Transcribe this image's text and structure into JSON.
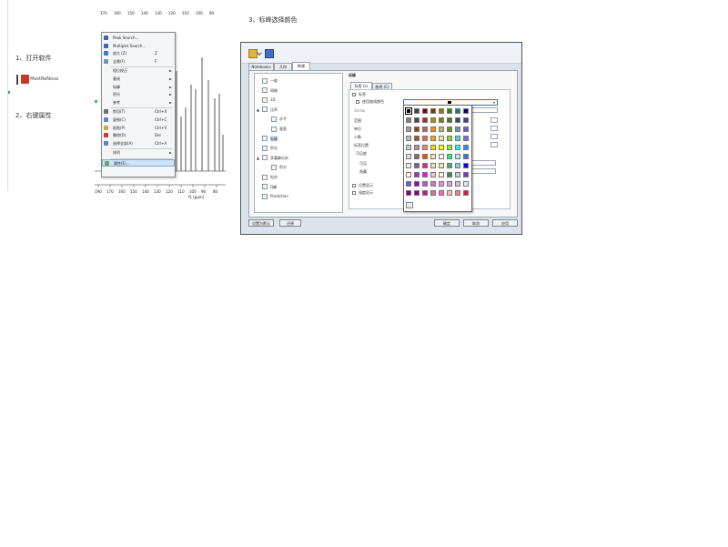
{
  "steps": {
    "step1": "1、打开软件",
    "step2": "2、右键属性",
    "step3": "3、标峰选择颜色"
  },
  "app": {
    "name": "MestReNova",
    "icon": "mestrenova-logo-icon"
  },
  "spectrum": {
    "tick_labels": [
      "190",
      "170",
      "160",
      "150",
      "140",
      "130",
      "120",
      "110",
      "100",
      "90",
      "80"
    ],
    "axis_title": "f1 (ppm)",
    "peak_labels": [
      "170",
      "160",
      "150",
      "140",
      "130",
      "120",
      "110",
      "100",
      "90"
    ]
  },
  "context_menu": {
    "items": [
      {
        "label": "Peak Search...",
        "shortcut": "",
        "arrow": "",
        "icon": "peak-search-icon",
        "color": "#3a62b8"
      },
      {
        "label": "Multiplet Search...",
        "shortcut": "",
        "arrow": "",
        "icon": "multiplet-search-icon",
        "color": "#3a62b8"
      },
      {
        "label": "放大 (Z)",
        "shortcut": "Z",
        "arrow": "",
        "icon": "zoom-in-icon",
        "color": "#2a7fd4"
      },
      {
        "label": "全景(F)",
        "shortcut": "F",
        "arrow": "",
        "icon": "full-view-icon",
        "color": "#6a8fb7"
      },
      {
        "label": "相位校正",
        "shortcut": "",
        "arrow": "►",
        "icon": "",
        "color": ""
      },
      {
        "label": "基线",
        "shortcut": "",
        "arrow": "►",
        "icon": "",
        "color": ""
      },
      {
        "label": "标峰",
        "shortcut": "",
        "arrow": "►",
        "icon": "",
        "color": ""
      },
      {
        "label": "积分",
        "shortcut": "",
        "arrow": "►",
        "icon": "",
        "color": ""
      },
      {
        "label": "参考",
        "shortcut": "",
        "arrow": "►",
        "icon": "",
        "color": ""
      },
      {
        "label": "剪切(T)",
        "shortcut": "Ctrl+X",
        "arrow": "",
        "icon": "cut-icon",
        "color": "#6d6d6d"
      },
      {
        "label": "复制(C)",
        "shortcut": "Ctrl+C",
        "arrow": "",
        "icon": "copy-icon",
        "color": "#5a84c2"
      },
      {
        "label": "粘贴(P)",
        "shortcut": "Ctrl+V",
        "arrow": "",
        "icon": "paste-icon",
        "color": "#d6a43a"
      },
      {
        "label": "删除(D)",
        "shortcut": "Del",
        "arrow": "",
        "icon": "delete-icon",
        "color": "#d0342c"
      },
      {
        "label": "选择全部(A)",
        "shortcut": "Ctrl+A",
        "arrow": "",
        "icon": "select-all-icon",
        "color": "#5a84c2"
      },
      {
        "label": "排列",
        "shortcut": "",
        "arrow": "►",
        "icon": "",
        "color": ""
      },
      {
        "label": "属性(E)...",
        "shortcut": "",
        "arrow": "",
        "icon": "properties-icon",
        "color": "#6aa84f"
      }
    ]
  },
  "dialog": {
    "tabs": [
      "Notebooks",
      "几何",
      "种谱"
    ],
    "tree": [
      {
        "label": "一般",
        "icon": "general-icon",
        "indent": 0
      },
      {
        "label": "网格",
        "icon": "grid-icon",
        "indent": 0
      },
      {
        "label": "1D",
        "icon": "1d-icon",
        "indent": 0
      },
      {
        "label": "比率",
        "icon": "ratio-icon",
        "indent": 0,
        "expand": "▲"
      },
      {
        "label": "水平",
        "icon": "horizontal-icon",
        "indent": 1
      },
      {
        "label": "垂直",
        "icon": "vertical-icon",
        "indent": 1
      },
      {
        "label": "标峰",
        "icon": "peak-label-icon",
        "indent": 0
      },
      {
        "label": "积分",
        "icon": "integral-icon",
        "indent": 0
      },
      {
        "label": "多重峰分析",
        "icon": "multiplet-icon",
        "indent": 0,
        "expand": "▲"
      },
      {
        "label": "积分",
        "icon": "integral-icon",
        "indent": 1
      },
      {
        "label": "拟合",
        "icon": "fit-icon",
        "indent": 0
      },
      {
        "label": "Q峰",
        "icon": "q-peak-icon",
        "indent": 0
      },
      {
        "label": "Prediction",
        "icon": "prediction-icon",
        "indent": 0
      }
    ],
    "section_title": "标峰",
    "sub_tabs": [
      "标签 (L)",
      "曲线 (C)"
    ],
    "labels": {
      "show_label": "标签",
      "use_curve_color": "使用曲线颜色",
      "stellar": "Stellar",
      "range": "范围",
      "unit": "单位",
      "decimals": "小数",
      "label_position": "标签位置",
      "visibility": "可见度",
      "visible": "可见",
      "hidden": "隐藏",
      "position_show": "位置显示",
      "intensity_show": "强度显示"
    },
    "more_button": "...",
    "buttons": {
      "set_default": "设置为默认",
      "restore": "还原",
      "ok": "确定",
      "cancel": "取消",
      "apply": "应用"
    },
    "selected_color": "#000000",
    "palette_colors": [
      [
        "#000000",
        "#404040",
        "#7f0000",
        "#7f3f00",
        "#7f7f00",
        "#3f7f00",
        "#007f7f",
        "#00007f"
      ],
      [
        "#808080",
        "#5f3f3f",
        "#a52a2a",
        "#b8860b",
        "#808000",
        "#556b2f",
        "#2f4f4f",
        "#483d8b"
      ],
      [
        "#a0a0a0",
        "#8b4513",
        "#cd5c5c",
        "#ff8c00",
        "#bdb76b",
        "#6b8e23",
        "#5f9ea0",
        "#6a5acd"
      ],
      [
        "#c0c0c0",
        "#a0522d",
        "#ff6347",
        "#ffa500",
        "#f0e68c",
        "#9acd32",
        "#40e0d0",
        "#7b68ee"
      ],
      [
        "#d0d0d0",
        "#bc8f8f",
        "#fa8072",
        "#ffd700",
        "#ffff00",
        "#7cfc00",
        "#00ffff",
        "#1e90ff"
      ],
      [
        "#e0e0e0",
        "#996666",
        "#ff4500",
        "#ffdead",
        "#ffffe0",
        "#00ff7f",
        "#afeeee",
        "#4169e1"
      ],
      [
        "#f0f0f0",
        "#666699",
        "#ff1493",
        "#ffdab9",
        "#eee8aa",
        "#3cb371",
        "#87ceeb",
        "#0000ff"
      ],
      [
        "#ffffff",
        "#9933cc",
        "#ff00ff",
        "#ffc0cb",
        "#fffacd",
        "#2e8b57",
        "#add8e6",
        "#8a2be2"
      ],
      [
        "#6a5acd",
        "#9400d3",
        "#ba55d3",
        "#da70d6",
        "#ee82ee",
        "#dda0dd",
        "#d8bfd8",
        "#e6e6fa"
      ],
      [
        "#800080",
        "#8b008b",
        "#c71585",
        "#db7093",
        "#ff69b4",
        "#ffb6c1",
        "#f08080",
        "#dc143c"
      ]
    ]
  }
}
